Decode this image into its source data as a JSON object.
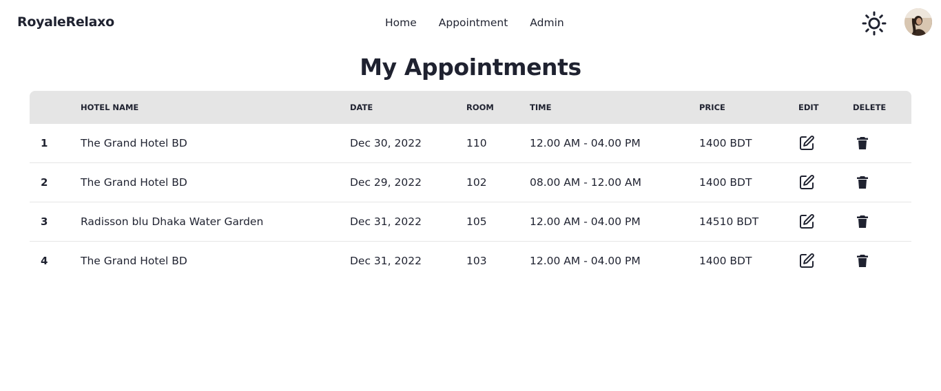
{
  "brand": "RoyaleRelaxo",
  "nav": {
    "home": "Home",
    "appointment": "Appointment",
    "admin": "Admin"
  },
  "icons": {
    "theme": "sun-icon",
    "edit": "edit-icon",
    "delete": "trash-icon"
  },
  "page_title": "My Appointments",
  "table": {
    "headers": {
      "index": "",
      "hotel": "Hotel Name",
      "date": "Date",
      "room": "Room",
      "time": "Time",
      "price": "Price",
      "edit": "Edit",
      "delete": "Delete"
    },
    "rows": [
      {
        "index": "1",
        "hotel": "The Grand Hotel BD",
        "date": "Dec 30, 2022",
        "room": "110",
        "time": "12.00 AM - 04.00 PM",
        "price": "1400 BDT"
      },
      {
        "index": "2",
        "hotel": "The Grand Hotel BD",
        "date": "Dec 29, 2022",
        "room": "102",
        "time": "08.00 AM - 12.00 AM",
        "price": "1400 BDT"
      },
      {
        "index": "3",
        "hotel": "Radisson blu Dhaka Water Garden",
        "date": "Dec 31, 2022",
        "room": "105",
        "time": "12.00 AM - 04.00 PM",
        "price": "14510 BDT"
      },
      {
        "index": "4",
        "hotel": "The Grand Hotel BD",
        "date": "Dec 31, 2022",
        "room": "103",
        "time": "12.00 AM - 04.00 PM",
        "price": "1400 BDT"
      }
    ]
  },
  "colors": {
    "text": "#1f2230",
    "header_bg": "#e5e5e5",
    "row_border": "#e5e5e5"
  }
}
